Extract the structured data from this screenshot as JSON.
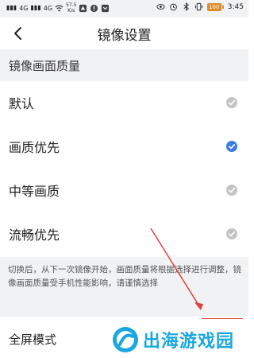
{
  "status_bar": {
    "signal_left": "4G",
    "signal_right": "4G",
    "net_speed_value": "57.5",
    "net_speed_unit": "K/s",
    "battery": "100",
    "time": "3:45"
  },
  "header": {
    "title": "镜像设置"
  },
  "quality_section": {
    "title": "镜像画面质量",
    "options": [
      {
        "label": "默认",
        "selected": false
      },
      {
        "label": "画质优先",
        "selected": true
      },
      {
        "label": "中等画质",
        "selected": false
      },
      {
        "label": "流畅优先",
        "selected": false
      }
    ],
    "note": "切换后，从下一次镜像开始，画面质量将根据选择进行调整，镜像画面质量受手机性能影响，请谨慎选择"
  },
  "fullscreen": {
    "label": "全屏模式"
  },
  "watermark": {
    "text": "出海游戏园"
  },
  "colors": {
    "selected_check": "#3d7be3",
    "unselected_check": "#c4c4c4",
    "section_bg": "#f1f2f4",
    "annotation_red": "#e0413a",
    "watermark_blue": "#1aa7e0"
  }
}
